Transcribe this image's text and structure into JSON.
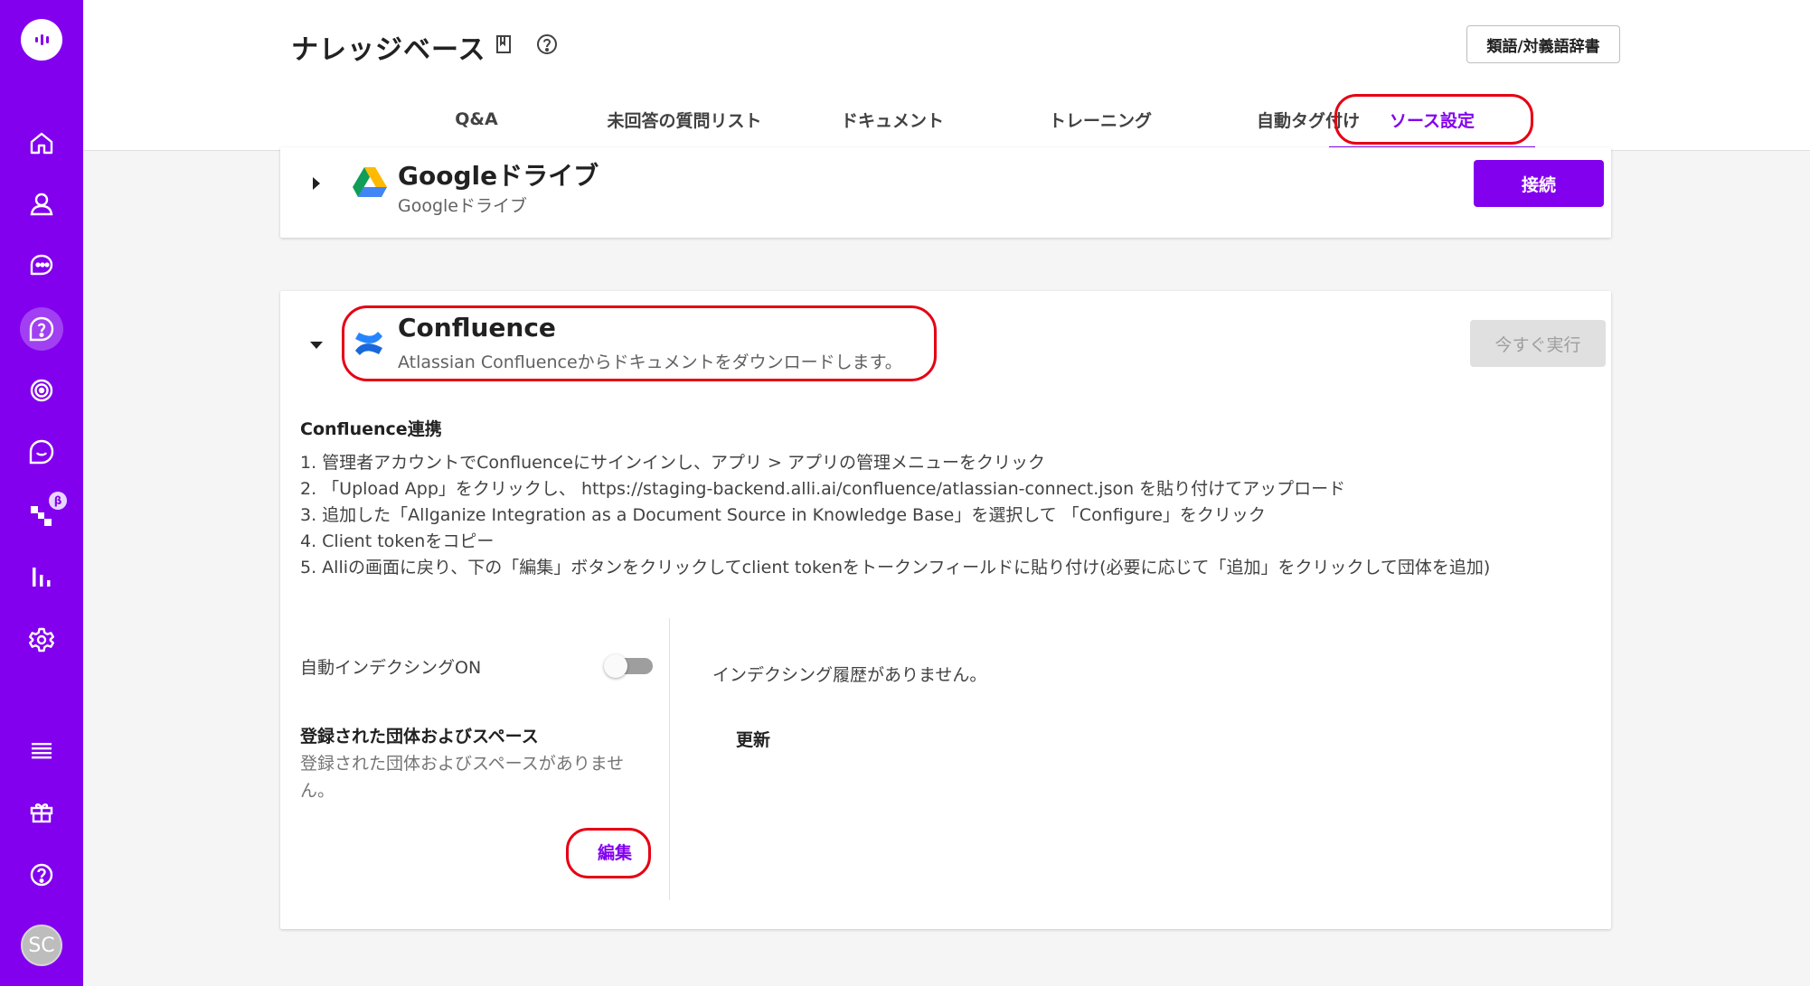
{
  "sidebar": {
    "nav_icons": [
      "home-icon",
      "user-icon",
      "chat-icon",
      "knowledge-base-icon",
      "fingerprint-icon",
      "conversation-icon",
      "flow-icon",
      "analytics-icon",
      "settings-icon"
    ],
    "bottom_icons": [
      "menu-icon",
      "gift-icon",
      "help-icon"
    ],
    "beta_badge": "β",
    "avatar_initials": "SC",
    "accent_color": "#8200ee"
  },
  "header": {
    "title": "ナレッジベース",
    "dict_button": "類語/対義語辞書",
    "tabs": [
      {
        "label": "Q&A"
      },
      {
        "label": "未回答の質問リスト"
      },
      {
        "label": "ドキュメント"
      },
      {
        "label": "トレーニング"
      },
      {
        "label": "自動タグ付け"
      },
      {
        "label": "ソース設定"
      }
    ],
    "active_tab": "ソース設定"
  },
  "google": {
    "title": "Googleドライブ",
    "description": "Googleドライブ",
    "connect_button": "接続"
  },
  "confluence": {
    "title": "Confluence",
    "description": "Atlassian Confluenceからドキュメントをダウンロードします。",
    "run_button": "今すぐ実行",
    "section_heading": "Confluence連携",
    "steps": [
      "1. 管理者アカウントでConfluenceにサインインし、アプリ > アプリの管理メニューをクリック",
      "2. 「Upload App」をクリックし、 https://staging-backend.alli.ai/confluence/atlassian-connect.json を貼り付けてアップロード",
      "3. 追加した「Allganize Integration as a Document Source in Knowledge Base」を選択して 「Configure」をクリック",
      "4. Client tokenをコピー",
      "5. Alliの画面に戻り、下の「編集」ボタンをクリックしてclient tokenをトークンフィールドに貼り付け(必要に応じて「追加」をクリックして団体を追加)"
    ],
    "auto_indexing_label": "自動インデクシングON",
    "auto_indexing_on": false,
    "registered_heading": "登録された団体およびスペース",
    "registered_empty": "登録された団体およびスペースがありません。",
    "edit_button": "編集",
    "history_empty": "インデクシング履歴がありません。",
    "refresh_label": "更新"
  }
}
